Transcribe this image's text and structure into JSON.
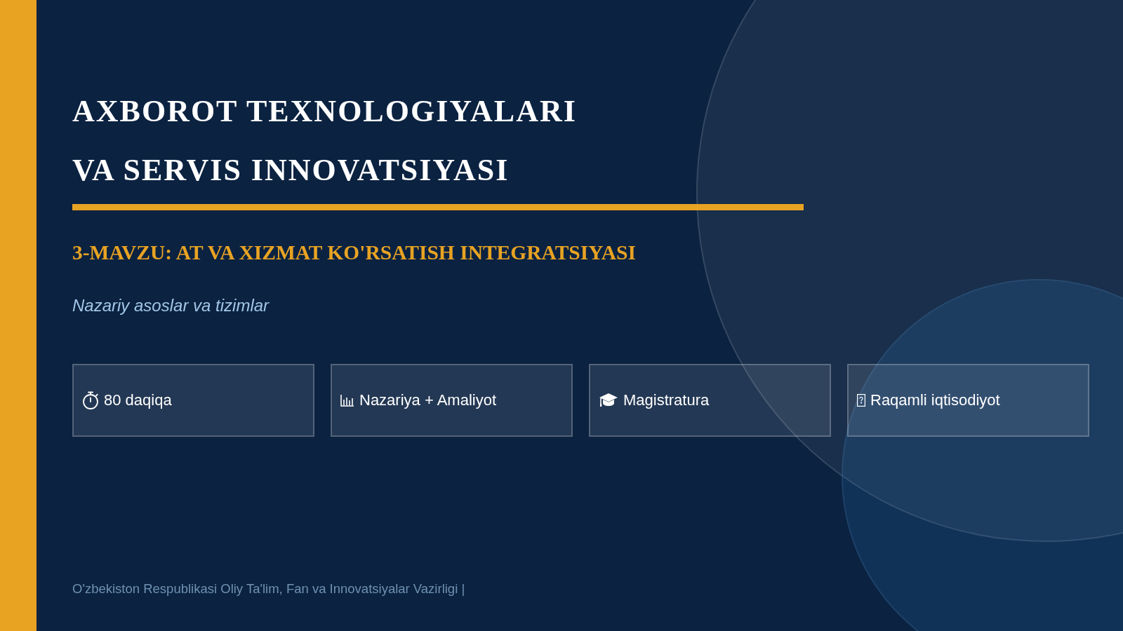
{
  "title_lines": [
    "AXBOROT TEXNOLOGIYALARI",
    "VA SERVIS INNOVATSIYASI"
  ],
  "topic": "3-MAVZU: AT VA XIZMAT KO'RSATISH INTEGRATSIYASI",
  "tagline": "Nazariy asoslar va tizimlar",
  "info_cards": [
    {
      "kind": "timer",
      "label": "80 daqiqa"
    },
    {
      "kind": "chart",
      "label": "Nazariya + Amaliyot"
    },
    {
      "kind": "graduation",
      "label": "Magistratura"
    },
    {
      "kind": "missing",
      "label": "Raqamli iqtisodiyot"
    }
  ],
  "footer": "O'zbekiston Respublikasi Oliy Ta'lim, Fan va Innovatsiyalar Vazirligi |"
}
